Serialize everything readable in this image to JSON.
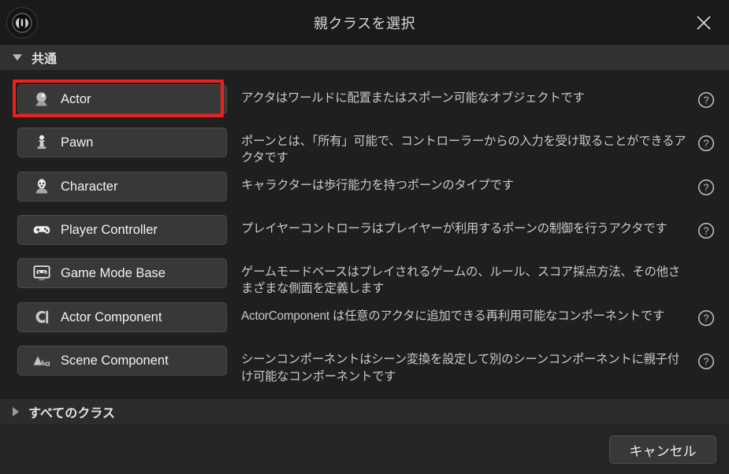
{
  "window": {
    "title": "親クラスを選択",
    "logo_icon": "unreal-engine-logo",
    "close_icon": "close-icon"
  },
  "common_section": {
    "label": "共通",
    "expanded": true,
    "expander_icon": "triangle-down-icon"
  },
  "classes": [
    {
      "name": "Actor",
      "icon": "actor-sphere-icon",
      "description": "アクタはワールドに配置またはスポーン可能なオブジェクトです",
      "help_icon": "help-circle-icon",
      "has_help": true,
      "highlighted": true
    },
    {
      "name": "Pawn",
      "icon": "pawn-chesspiece-icon",
      "description": "ポーンとは、「所有」可能で、コントローラーからの入力を受け取ることができるアクタです",
      "help_icon": "help-circle-icon",
      "has_help": true,
      "highlighted": false
    },
    {
      "name": "Character",
      "icon": "character-head-icon",
      "description": "キャラクターは歩行能力を持つポーンのタイプです",
      "help_icon": "help-circle-icon",
      "has_help": true,
      "highlighted": false
    },
    {
      "name": "Player Controller",
      "icon": "gamepad-icon",
      "description": "プレイヤーコントローラはプレイヤーが利用するポーンの制御を行うアクタです",
      "help_icon": "help-circle-icon",
      "has_help": true,
      "highlighted": false
    },
    {
      "name": "Game Mode Base",
      "icon": "gamemode-screen-icon",
      "description": "ゲームモードベースはプレイされるゲームの、ルール、スコア採点方法、その他さまざまな側面を定義します",
      "help_icon": "help-circle-icon",
      "has_help": false,
      "highlighted": false
    },
    {
      "name": "Actor Component",
      "icon": "actor-component-icon",
      "description": "ActorComponent は任意のアクタに追加できる再利用可能なコンポーネントです",
      "help_icon": "help-circle-icon",
      "has_help": true,
      "highlighted": false
    },
    {
      "name": "Scene Component",
      "icon": "scene-component-icon",
      "description": "シーンコンポーネントはシーン変換を設定して別のシーンコンポーネントに親子付け可能なコンポーネントです",
      "help_icon": "help-circle-icon",
      "has_help": true,
      "highlighted": false
    }
  ],
  "all_classes_section": {
    "label": "すべてのクラス",
    "expanded": false,
    "expander_icon": "triangle-right-icon"
  },
  "footer": {
    "cancel_label": "キャンセル"
  },
  "colors": {
    "highlight": "#f01f1f",
    "panel_bg": "#1f1f1f",
    "dialog_bg": "#242424",
    "titlebar_bg": "#1a1a1a",
    "button_bg": "#383838"
  }
}
